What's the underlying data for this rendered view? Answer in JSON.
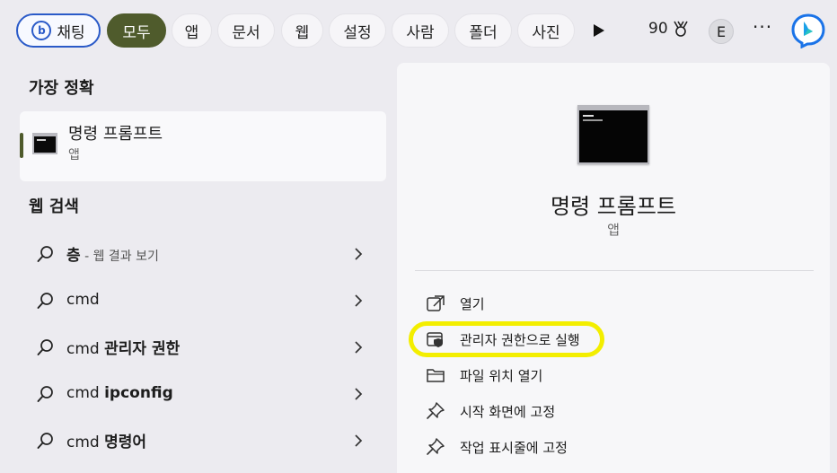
{
  "filter_bar": {
    "chat_label": "채팅",
    "filters": [
      "모두",
      "앱",
      "문서",
      "웹",
      "설정",
      "사람",
      "폴더",
      "사진"
    ],
    "active_filter": "모두",
    "points": "90",
    "avatar_initial": "E",
    "more_label": "···"
  },
  "left": {
    "best_match_header": "가장 정확",
    "best_match": {
      "title": "명령 프롬프트",
      "subtitle": "앱",
      "icon": "command-prompt-icon"
    },
    "web_search_header": "웹 검색",
    "web_results": [
      {
        "query": "층",
        "hint": " - 웹 결과 보기"
      },
      {
        "prefix": "cmd",
        "bold": ""
      },
      {
        "prefix": "cmd ",
        "bold": "관리자 권한"
      },
      {
        "prefix": "cmd ",
        "bold": "ipconfig"
      },
      {
        "prefix": "cmd ",
        "bold": "명령어"
      }
    ]
  },
  "preview": {
    "title": "명령 프롬프트",
    "subtitle": "앱",
    "actions": [
      {
        "label": "열기",
        "icon": "open-external-icon"
      },
      {
        "label": "관리자 권한으로 실행",
        "icon": "shield-admin-icon"
      },
      {
        "label": "파일 위치 열기",
        "icon": "folder-icon"
      },
      {
        "label": "시작 화면에 고정",
        "icon": "pin-icon"
      },
      {
        "label": "작업 표시줄에 고정",
        "icon": "pin-icon"
      }
    ]
  },
  "colors": {
    "accent": "#4f5b2c",
    "chat_border": "#2a5ac8",
    "highlight": "#f3ee00"
  }
}
